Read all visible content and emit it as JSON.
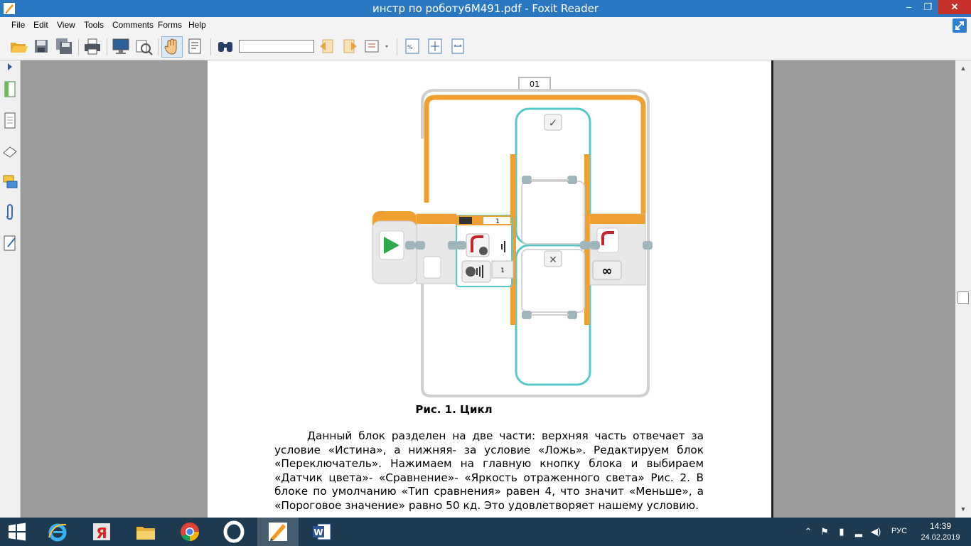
{
  "window": {
    "title": "инстр по роботу6М491.pdf - Foxit Reader",
    "minimize_glyph": "‒",
    "maximize_glyph": "❐",
    "close_glyph": "✕"
  },
  "menu": {
    "items": [
      "File",
      "Edit",
      "View",
      "Tools",
      "Comments",
      "Forms",
      "Help"
    ]
  },
  "toolbar": {
    "find_value": "",
    "icons": [
      "open-icon",
      "save-icon",
      "save-all-icon",
      "print-icon",
      "screen-icon",
      "scan-icon",
      "hand-tool-icon",
      "select-text-icon",
      "find-binoculars-icon",
      "prev-find-icon",
      "next-find-icon",
      "highlight-icon",
      "zoom-percent-icon",
      "fit-page-icon",
      "fit-width-icon"
    ]
  },
  "sidebar": {
    "icons": [
      "expand-arrow-icon",
      "bookmarks-icon",
      "pages-icon",
      "layers-icon",
      "comments-icon",
      "attachments-icon",
      "signatures-icon"
    ]
  },
  "document": {
    "figure": {
      "loop_label": "01",
      "switch_value": "1",
      "switch_port_value": "1",
      "true_glyph": "✓",
      "false_glyph": "✕",
      "infinity_glyph": "∞"
    },
    "caption": "Рис. 1. Цикл",
    "paragraph": "Данный блок разделен на две части: верхняя часть отвечает за условие «Истина», а нижняя- за условие «Ложь». Редактируем блок «Переключатель». Нажимаем на главную кнопку блока и выбираем «Датчик цвета»- «Сравнение»- «Яркость отраженного света» Рис. 2. В блоке по умолчанию «Тип сравнения» равен 4, что значит «Меньше», а «Пороговое значение» равно 50 кд. Это удовлетворяет нашему условию."
  },
  "taskbar": {
    "apps": [
      "start-icon",
      "internet-explorer-icon",
      "yandex-icon",
      "file-explorer-icon",
      "chrome-icon",
      "opera-icon",
      "foxit-reader-icon",
      "word-icon"
    ],
    "language": "РУС",
    "time": "14:39",
    "date": "24.02.2019"
  },
  "colors": {
    "titlebar": "#2b78c2",
    "taskbar": "#1e3a50",
    "loop_orange": "#f0a030",
    "switch_teal": "#56c8c8",
    "start_green": "#2ea84a"
  }
}
